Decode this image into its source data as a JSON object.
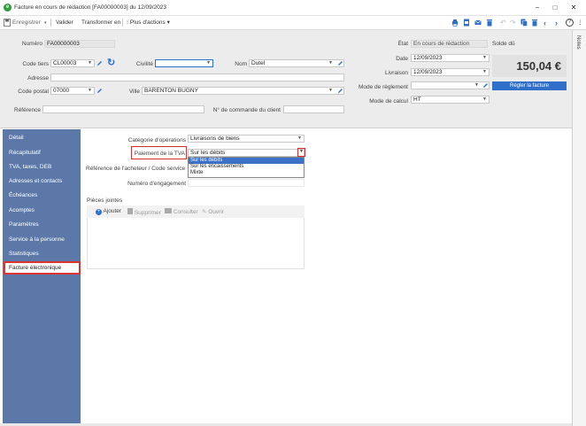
{
  "window": {
    "title": "Facture en cours de rédaction [FA00000003] du 12/09/2023",
    "minimize": "−",
    "maximize": "□",
    "close": "✕"
  },
  "toolbar": {
    "save": "Enregistrer",
    "validate": "Valider",
    "transform": "Transformer en",
    "more_actions": "Plus d'actions",
    "help": "?"
  },
  "header": {
    "numero_label": "Numéro",
    "numero_value": "FA00000003",
    "code_tiers_label": "Code tiers",
    "code_tiers_value": "CL00003",
    "civilite_label": "Civilité",
    "civilite_value": "",
    "nom_label": "Nom",
    "nom_value": "Dutel",
    "adresse_label": "Adresse",
    "adresse_value": "",
    "code_postal_label": "Code postal",
    "code_postal_value": "07000",
    "ville_label": "Ville",
    "ville_value": "BARENTON BUGNY",
    "reference_label": "Référence",
    "reference_value": "",
    "commande_label": "N° de commande du client",
    "commande_value": "",
    "etat_label": "État",
    "etat_value": "En cours de rédaction",
    "solde_label": "Solde dû",
    "date_label": "Date",
    "date_value": "12/09/2023",
    "livraison_label": "Livraison",
    "livraison_value": "12/09/2023",
    "mode_reglement_label": "Mode de règlement",
    "mode_reglement_value": "",
    "mode_calcul_label": "Mode de calcul",
    "mode_calcul_value": "HT",
    "amount": "150,04 €",
    "regler_label": "Régler la facture"
  },
  "notes_tab": "Notes",
  "sidebar": {
    "items": [
      {
        "label": "Détail"
      },
      {
        "label": "Récapitulatif"
      },
      {
        "label": "TVA, taxes, DEB"
      },
      {
        "label": "Adresses et contacts"
      },
      {
        "label": "Échéances"
      },
      {
        "label": "Acomptes"
      },
      {
        "label": "Paramètres"
      },
      {
        "label": "Service à la personne"
      },
      {
        "label": "Statistiques"
      },
      {
        "label": "Facture électronique"
      }
    ],
    "active_index": 9
  },
  "content": {
    "categorie_label": "Catégorie d'opérations",
    "categorie_value": "Livraisons de biens",
    "paiement_label": "Paiement de la TVA",
    "paiement_value": "Sur les débits",
    "paiement_options": [
      "Sur les débits",
      "Sur les encaissements",
      "Mixte"
    ],
    "reference_acheteur_label": "Référence de l'acheteur / Code service",
    "engagement_label": "Numéro d'engagement",
    "pieces_jointes_label": "Pièces jointes",
    "pj_add": "Ajouter",
    "pj_delete": "Supprimer",
    "pj_consult": "Consulter",
    "pj_open": "Ouvrir"
  },
  "colors": {
    "sidebar_bg": "#5b78a8",
    "accent_blue": "#2f6fc9",
    "highlight_red": "#d62f2f",
    "header_bg": "#ececec"
  }
}
